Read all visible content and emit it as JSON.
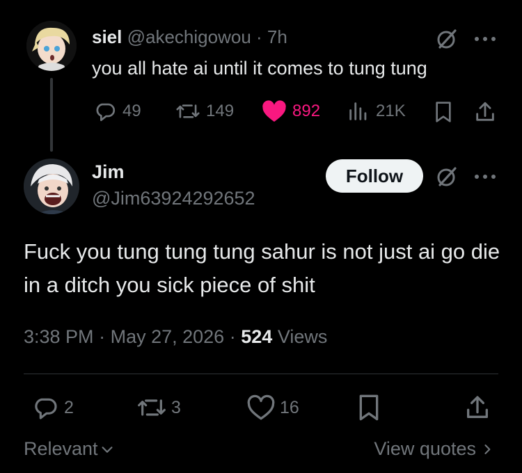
{
  "parent_tweet": {
    "display_name": "siel",
    "handle": "@akechigowou",
    "separator": "·",
    "time": "7h",
    "text": "you all hate ai until it comes to tung tung",
    "stats": {
      "replies": "49",
      "reposts": "149",
      "likes": "892",
      "views": "21K"
    }
  },
  "reply_tweet": {
    "display_name": "Jim",
    "handle": "@Jim63924292652",
    "follow_label": "Follow",
    "text": "Fuck you tung tung tung sahur is not just ai go die in a ditch you sick piece of shit",
    "time": "3:38 PM",
    "date": "May 27, 2026",
    "separator": "·",
    "views_count": "524",
    "views_label": "Views",
    "stats": {
      "replies": "2",
      "reposts": "3",
      "likes": "16"
    }
  },
  "footer": {
    "sort_label": "Relevant",
    "view_quotes_label": "View quotes"
  },
  "colors": {
    "background": "#000000",
    "text_primary": "#e7e9ea",
    "text_secondary": "#71767b",
    "like_active": "#f91880",
    "divider": "#2f3336",
    "follow_button_bg": "#eff3f4"
  },
  "icons": [
    "grok-icon",
    "more-icon",
    "reply-icon",
    "repost-icon",
    "heart-icon",
    "views-icon",
    "bookmark-icon",
    "share-icon",
    "chevron-down-icon",
    "chevron-right-icon"
  ]
}
